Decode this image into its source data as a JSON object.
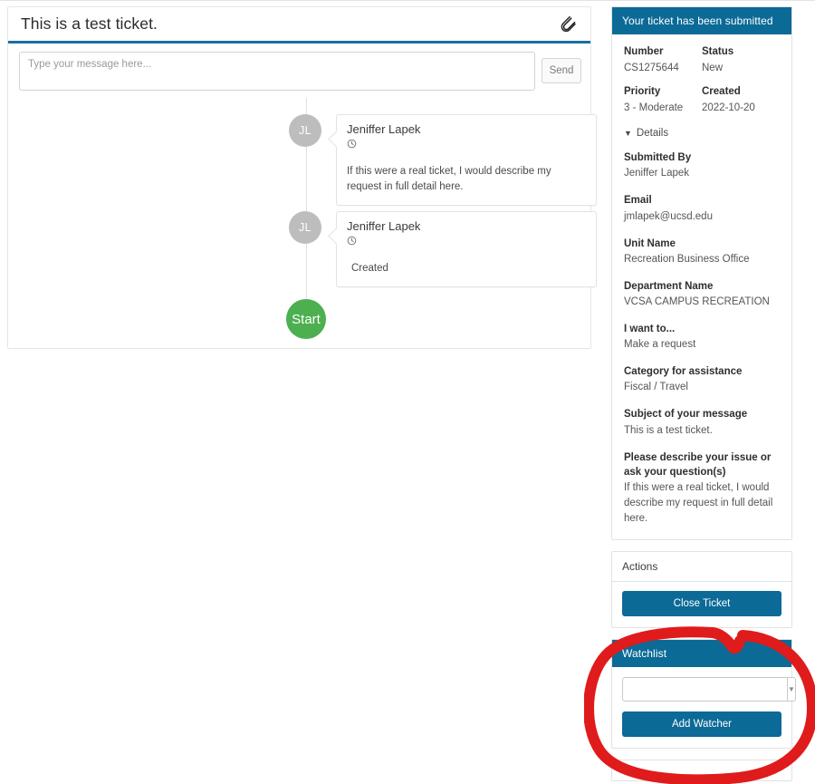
{
  "ticket": {
    "title": "This is a test ticket.",
    "attach_icon": "paperclip-icon"
  },
  "compose": {
    "placeholder": "Type your message here...",
    "value": "",
    "send_label": "Send"
  },
  "timeline": {
    "start_label": "Start",
    "entries": [
      {
        "initials": "JL",
        "author": "Jeniffer Lapek",
        "time_icon": "clock-icon",
        "body": "If this were a real ticket, I would describe my request in full detail here."
      },
      {
        "initials": "JL",
        "author": "Jeniffer Lapek",
        "time_icon": "clock-icon",
        "body": "Created"
      }
    ]
  },
  "sidebar": {
    "submitted_panel": {
      "header": "Your ticket has been submitted",
      "summary": [
        {
          "label": "Number",
          "value": "CS1275644"
        },
        {
          "label": "Status",
          "value": "New"
        },
        {
          "label": "Priority",
          "value": "3 - Moderate"
        },
        {
          "label": "Created",
          "value": "2022-10-20"
        }
      ],
      "details_toggle": "Details",
      "details_chevron": "chevron-down-icon",
      "fields": [
        {
          "label": "Submitted By",
          "value": "Jeniffer Lapek"
        },
        {
          "label": "Email",
          "value": "jmlapek@ucsd.edu"
        },
        {
          "label": "Unit Name",
          "value": "Recreation Business Office"
        },
        {
          "label": "Department Name",
          "value": "VCSA CAMPUS RECREATION"
        },
        {
          "label": "I want to...",
          "value": "Make a request"
        },
        {
          "label": "Category for assistance",
          "value": "Fiscal / Travel"
        },
        {
          "label": "Subject of your message",
          "value": "This is a test ticket."
        },
        {
          "label": "Please describe your issue or ask your question(s)",
          "value": "If this were a real ticket, I would describe my request in full detail here."
        }
      ]
    },
    "actions_panel": {
      "header": "Actions",
      "close_ticket_label": "Close Ticket"
    },
    "watchlist_panel": {
      "header": "Watchlist",
      "select_value": "",
      "caret_icon": "chevron-down-icon",
      "add_watcher_label": "Add Watcher"
    }
  },
  "annotation": {
    "shape": "hand-drawn-red-ellipse",
    "color": "#e01b1b"
  }
}
